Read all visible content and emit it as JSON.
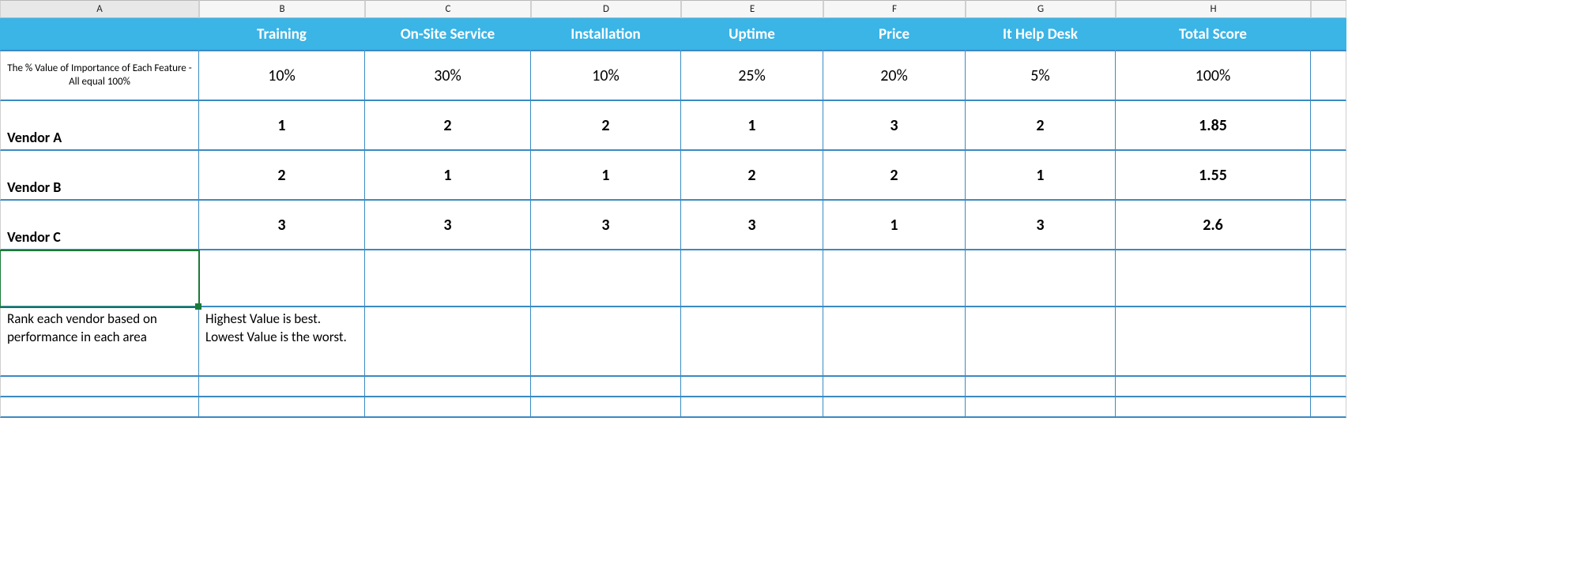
{
  "columns": [
    "A",
    "B",
    "C",
    "D",
    "E",
    "F",
    "G",
    "H"
  ],
  "header": {
    "blank": "",
    "c1": "Training",
    "c2": "On-Site Service",
    "c3": "Installation",
    "c4": "Uptime",
    "c5": "Price",
    "c6": "It Help Desk",
    "c7": "Total Score"
  },
  "importance": {
    "label": "The % Value of Importance of Each Feature - All equal 100%",
    "c1": "10%",
    "c2": "30%",
    "c3": "10%",
    "c4": "25%",
    "c5": "20%",
    "c6": "5%",
    "c7": "100%"
  },
  "vendors": [
    {
      "name": "Vendor A",
      "v": [
        "1",
        "2",
        "2",
        "1",
        "3",
        "2",
        "1.85"
      ]
    },
    {
      "name": "Vendor B",
      "v": [
        "2",
        "1",
        "1",
        "2",
        "2",
        "1",
        "1.55"
      ]
    },
    {
      "name": "Vendor C",
      "v": [
        "3",
        "3",
        "3",
        "3",
        "1",
        "3",
        "2.6"
      ]
    }
  ],
  "notes": {
    "a": "Rank each vendor based on performance in each area",
    "b": "Highest Value is best. Lowest Value is the worst."
  },
  "selected_cell": "A6",
  "chart_data": {
    "type": "table",
    "title": "Vendor weighted scoring matrix",
    "columns": [
      "Training",
      "On-Site Service",
      "Installation",
      "Uptime",
      "Price",
      "It Help Desk",
      "Total Score"
    ],
    "weights_percent": [
      10,
      30,
      10,
      25,
      20,
      5,
      100
    ],
    "rows": [
      {
        "vendor": "Vendor A",
        "scores": [
          1,
          2,
          2,
          1,
          3,
          2
        ],
        "total": 1.85
      },
      {
        "vendor": "Vendor B",
        "scores": [
          2,
          1,
          1,
          2,
          2,
          1
        ],
        "total": 1.55
      },
      {
        "vendor": "Vendor C",
        "scores": [
          3,
          3,
          3,
          3,
          1,
          3
        ],
        "total": 2.6
      }
    ],
    "notes": "Rank each vendor based on performance in each area. Highest value is best; lowest value is worst."
  }
}
